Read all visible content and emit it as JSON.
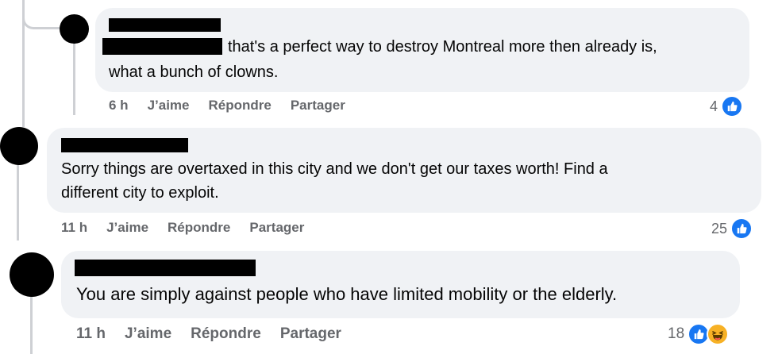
{
  "comments": [
    {
      "text_line1": "that's a perfect way to destroy Montreal more then already is,",
      "text_line2": "what a bunch of clowns.",
      "time": "6 h",
      "like": "J’aime",
      "reply": "Répondre",
      "share": "Partager",
      "reaction_count": "4"
    },
    {
      "text_line1": "Sorry things are overtaxed in this city and we don't get our taxes worth! Find a",
      "text_line2": "different city to exploit.",
      "time": "11 h",
      "like": "J’aime",
      "reply": "Répondre",
      "share": "Partager",
      "reaction_count": "25"
    },
    {
      "text_line1": "You are simply against people who have limited mobility or the elderly.",
      "time": "11 h",
      "like": "J’aime",
      "reply": "Répondre",
      "share": "Partager",
      "reaction_count": "18"
    }
  ],
  "colors": {
    "bubble": "#f0f2f5",
    "like_blue": "#1877f2",
    "haha_yellow": "#f7b125",
    "meta_text": "#65676b"
  },
  "icons": [
    "like-icon",
    "haha-icon"
  ]
}
